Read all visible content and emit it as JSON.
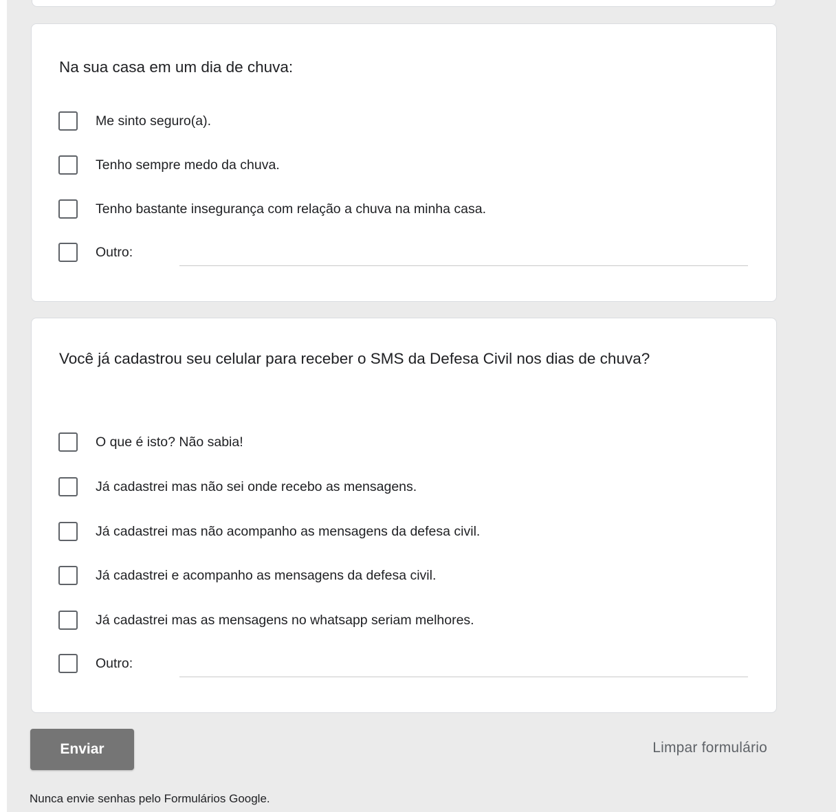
{
  "question1": {
    "title": "Na sua casa em um dia de chuva:",
    "options": [
      "Me sinto seguro(a).",
      "Tenho sempre medo da chuva.",
      "Tenho bastante insegurança com relação a chuva na minha casa.",
      "Outro:"
    ]
  },
  "question2": {
    "title": "Você já cadastrou seu celular para receber o SMS da Defesa Civil nos dias de chuva?",
    "options": [
      "O que é isto? Não sabia!",
      "Já cadastrei mas não sei onde recebo as mensagens.",
      "Já cadastrei mas não acompanho as mensagens da defesa civil.",
      "Já cadastrei e acompanho as mensagens da defesa civil.",
      "Já cadastrei mas as mensagens no whatsapp seriam melhores.",
      "Outro:"
    ]
  },
  "actions": {
    "submit_label": "Enviar",
    "clear_label": "Limpar formulário"
  },
  "footer": {
    "note": "Nunca envie senhas pelo Formulários Google."
  },
  "colors": {
    "background": "#ebebeb",
    "card": "#ffffff",
    "submit_button": "#757575",
    "checkbox_border": "#5f6368"
  }
}
